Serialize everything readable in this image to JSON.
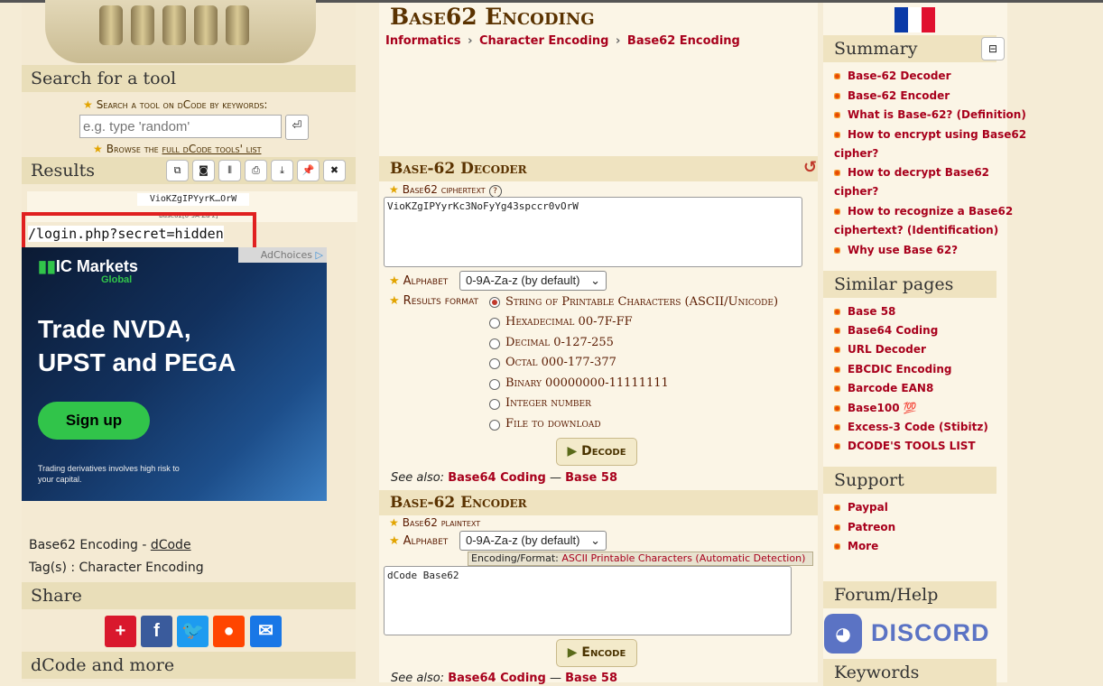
{
  "page_title": "Base62 Encoding",
  "breadcrumb": [
    "Informatics",
    "Character Encoding",
    "Base62 Encoding"
  ],
  "search": {
    "heading": "Search for a tool",
    "prompt": "Search a tool on dCode by keywords:",
    "placeholder": "e.g. type 'random'",
    "browse_prefix": "Browse the",
    "browse_link": "full dCode tools' list"
  },
  "results": {
    "heading": "Results",
    "toolbar_icons": [
      "copy-icon",
      "camera-icon",
      "columns-icon",
      "print-icon",
      "download-icon",
      "pin-icon",
      "close-icon"
    ],
    "line1": "VioKZgIPYyrK…OrW",
    "line2": "Base62[0-9A-Za-z]",
    "highlighted_output": "/login.php?secret=hidden"
  },
  "ad": {
    "brand": "IC Markets",
    "brand_sub": "Global",
    "choices": "AdChoices",
    "headline": "Trade NVDA, UPST and PEGA",
    "cta": "Sign up",
    "disclaimer": "Trading derivatives involves high risk to your capital."
  },
  "page_info": {
    "title_prefix": "Base62 Encoding -",
    "title_link": "dCode",
    "tags": "Tag(s) : Character Encoding"
  },
  "share": {
    "heading": "Share",
    "buttons": [
      "share-plus",
      "facebook",
      "twitter",
      "reddit",
      "email"
    ]
  },
  "more_heading": "dCode and more",
  "decoder": {
    "heading": "Base-62 Decoder",
    "cipher_label": "Base62 ciphertext",
    "cipher_value": "VioKZgIPYyrKc3NoFyYg43spccr0vOrW",
    "alphabet_label": "Alphabet",
    "alphabet_value": "0-9A-Za-z (by default)",
    "format_label": "Results format",
    "formats": [
      "String of Printable Characters (ASCII/Unicode)",
      "Hexadecimal 00-7F-FF",
      "Decimal 0-127-255",
      "Octal 000-177-377",
      "Binary 00000000-11111111",
      "Integer number",
      "File to download"
    ],
    "selected_format_index": 0,
    "button": "Decode",
    "see_also_label": "See also:",
    "see_also": [
      "Base64 Coding",
      "Base 58"
    ]
  },
  "encoder": {
    "heading": "Base-62 Encoder",
    "plain_label": "Base62 plaintext",
    "alphabet_label": "Alphabet",
    "alphabet_value": "0-9A-Za-z (by default)",
    "encoding_label": "Encoding/Format:",
    "encoding_value": "ASCII Printable Characters (Automatic Detection)",
    "plain_value": "dCode Base62",
    "button": "Encode",
    "see_also_label": "See also:",
    "see_also": [
      "Base64 Coding",
      "Base 58"
    ]
  },
  "summary": {
    "heading": "Summary",
    "items": [
      "Base-62 Decoder",
      "Base-62 Encoder",
      "What is Base-62? (Definition)",
      "How to encrypt using Base62",
      "cipher?",
      "How to decrypt Base62",
      "cipher?",
      "How to recognize a Base62",
      "ciphertext? (Identification)",
      "Why use Base 62?"
    ]
  },
  "similar": {
    "heading": "Similar pages",
    "items": [
      "Base 58",
      "Base64 Coding",
      "URL Decoder",
      "EBCDIC Encoding",
      "Barcode EAN8",
      "Base100 💯",
      "Excess-3 Code (Stibitz)",
      "DCODE'S TOOLS LIST"
    ]
  },
  "support": {
    "heading": "Support",
    "items": [
      "Paypal",
      "Patreon",
      "More"
    ]
  },
  "forum": {
    "heading": "Forum/Help",
    "discord": "DISCORD"
  },
  "keywords_heading": "Keywords",
  "colors": {
    "accent_red": "#a8001c",
    "highlight_box": "#e02020",
    "page_bg": "#f5ecd6",
    "header_bg": "#efe3c0"
  }
}
